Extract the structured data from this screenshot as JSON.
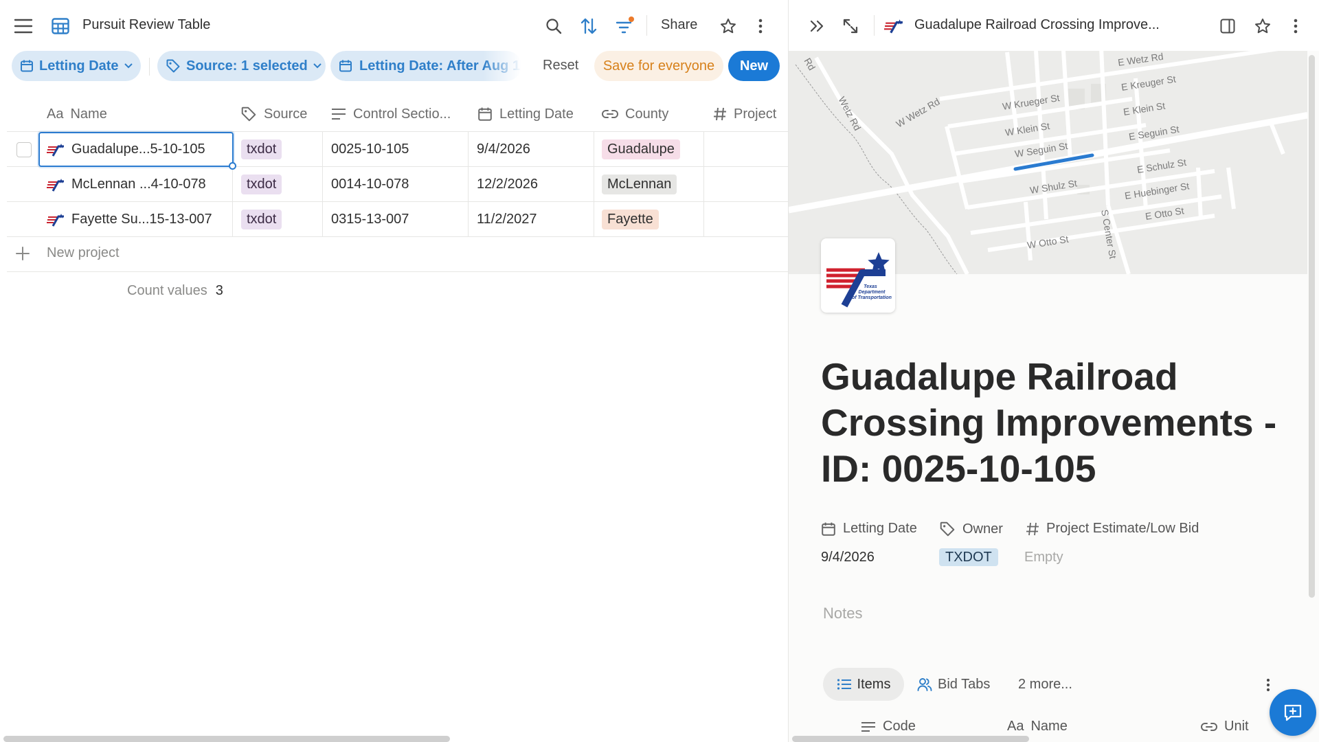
{
  "left": {
    "title": "Pursuit Review Table",
    "share": "Share",
    "filters": {
      "sort_pill": "Letting Date",
      "source_pill": "Source: 1 selected",
      "date_pill": "Letting Date: After Aug 1",
      "reset": "Reset",
      "save": "Save for everyone",
      "new": "New"
    },
    "columns": {
      "name_prefix": "Aa",
      "name": "Name",
      "source": "Source",
      "control": "Control Sectio...",
      "letting": "Letting Date",
      "county": "County",
      "project": "Project"
    },
    "rows": [
      {
        "name": "Guadalupe...5-10-105",
        "source": "txdot",
        "control": "0025-10-105",
        "date": "9/4/2026",
        "county": "Guadalupe",
        "county_color": "#f6dde8"
      },
      {
        "name": "McLennan ...4-10-078",
        "source": "txdot",
        "control": "0014-10-078",
        "date": "12/2/2026",
        "county": "McLennan",
        "county_color": "#e6e6e4"
      },
      {
        "name": "Fayette Su...15-13-007",
        "source": "txdot",
        "control": "0315-13-007",
        "date": "11/2/2027",
        "county": "Fayette",
        "county_color": "#f8e0d4"
      }
    ],
    "new_row": "New project",
    "count_label": "Count values",
    "count_value": "3"
  },
  "right": {
    "header_title": "Guadalupe Railroad Crossing Improve...",
    "map_labels": [
      "E Wetz Rd",
      "E Kreuger St",
      "W Wetz Rd",
      "W Krueger St",
      "E Klein St",
      "W Klein St",
      "E Seguin St",
      "Wetz Rd",
      "W Seguin St",
      "E Schulz St",
      "W Shulz St",
      "E Huebinger St",
      "E Otto St",
      "W Otto St",
      "S Center St",
      "Rd"
    ],
    "page_title": "Guadalupe Railroad Crossing Improvements - ID: 0025-10-105",
    "props": {
      "letting_label": "Letting Date",
      "owner_label": "Owner",
      "estimate_label": "Project Estimate/Low Bid",
      "letting_value": "9/4/2026",
      "owner_value": "TXDOT",
      "estimate_value": "Empty"
    },
    "notes_placeholder": "Notes",
    "tabs": {
      "items": "Items",
      "bid_tabs": "Bid Tabs",
      "more": "2 more..."
    },
    "sub_columns": {
      "code": "Code",
      "name_prefix": "Aa",
      "name": "Name",
      "unit": "Unit"
    }
  },
  "colors": {
    "accent": "#1b7ad6",
    "filter_bg": "#dbe9f6",
    "source_tag": "#eadff0",
    "save_text": "#d7811b",
    "txdot_tag": "#cfe2f0"
  },
  "icons": [
    "menu-icon",
    "table-icon",
    "search-icon",
    "sort-icon",
    "filter-icon",
    "star-icon",
    "more-icon",
    "calendar-icon",
    "tag-icon",
    "chevron-down-icon",
    "text-lines-icon",
    "link-icon",
    "hash-icon",
    "plus-icon",
    "double-chevron-icon",
    "expand-icon",
    "sidebar-icon",
    "list-icon",
    "people-icon",
    "chat-icon",
    "txdot-logo"
  ]
}
